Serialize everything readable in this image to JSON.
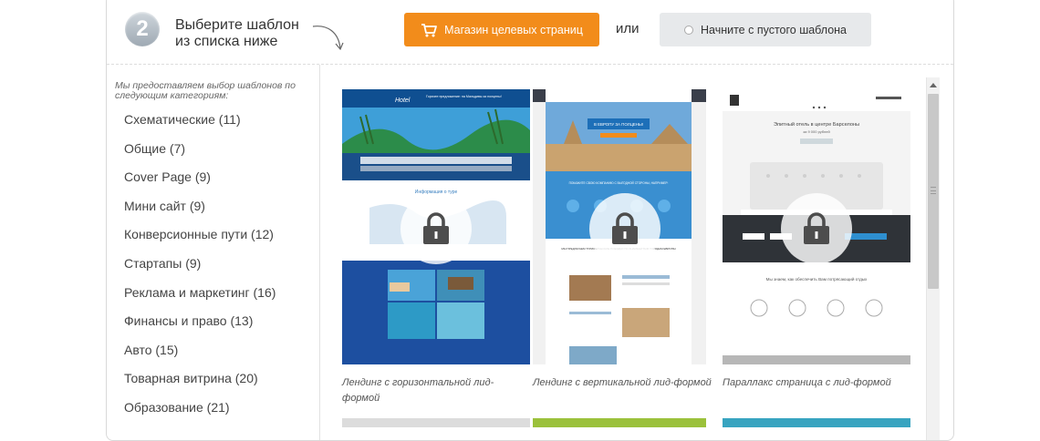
{
  "header": {
    "step_number": "2",
    "step_text_line1": "Выберите шаблон",
    "step_text_line2": "из списка ниже",
    "store_button_label": "Магазин целевых страниц",
    "or_label": "или",
    "blank_button_label": "Начните с пустого шаблона",
    "accent_color": "#f28c1b"
  },
  "sidebar": {
    "intro": "Мы предоставляем выбор шаблонов по следующим категориям:",
    "categories": [
      "Схематические (11)",
      "Общие (7)",
      "Cover Page (9)",
      "Мини сайт (9)",
      "Конверсионные пути (12)",
      "Стартапы (9)",
      "Реклама и маркетинг (16)",
      "Финансы и право (13)",
      "Авто (15)",
      "Товарная витрина (20)",
      "Образование (21)"
    ]
  },
  "templates": [
    {
      "caption": "Лендинг с горизонтальной лид-формой",
      "preview_texts": [
        "Hotel",
        "Горячее предложение: на Мальдивы за полцены!",
        "Информация о туре"
      ]
    },
    {
      "caption": "Лендинг с вертикальной лид-формой",
      "preview_texts": [
        "В ЕВРОПУ ЗА ПОЛЦЕНЫ!",
        "ПОКАЖИТЕ СВОЮ КОМПАНИЮ С ВЫГОДНОЙ СТОРОНЫ, НАПРИМЕР:",
        "МЫ ПРЕДЛАГАЕМ ТУРИСТИЧЕСКИЕ ПОЕЗДКИ ПО ЗНАМЕНИТЫМ ГОРОДАМ ЕВРОПЫ"
      ]
    },
    {
      "caption": "Параллакс страница с лид-формой",
      "preview_texts": [
        "Элитный отель в центре Барселоны",
        "за 9 000 рублей",
        "Мы знаем, как обеспечить Вам потрясающий отдых"
      ]
    }
  ]
}
